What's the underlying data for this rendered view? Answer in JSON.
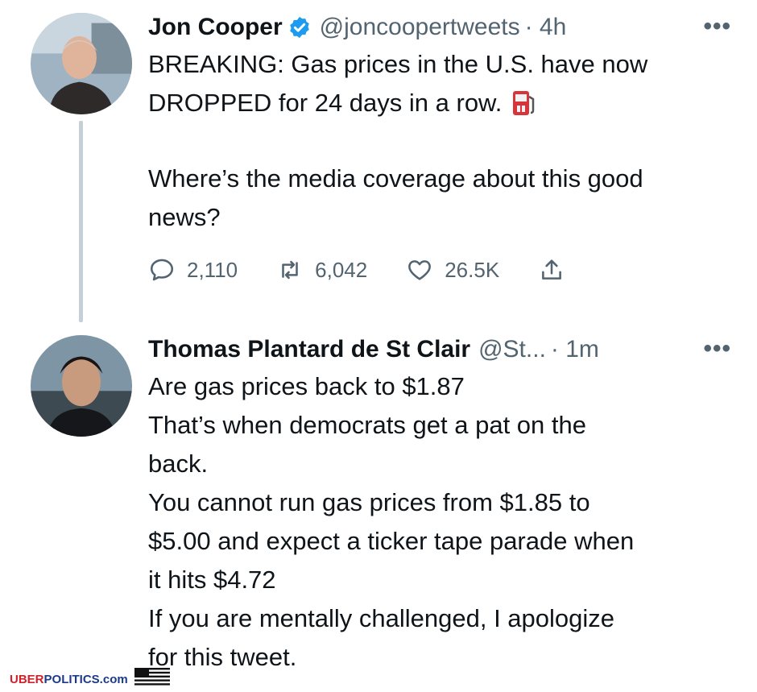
{
  "tweets": [
    {
      "name": "Jon Cooper",
      "verified": true,
      "handle": "@joncoopertweets",
      "time": "· 4h",
      "more": "•••",
      "line1": "BREAKING: Gas prices in the U.S. have now",
      "line2": "DROPPED for 24 days in a row.",
      "line3": "Where’s the media coverage about this good",
      "line4": "news?",
      "replies": "2,110",
      "retweets": "6,042",
      "likes": "26.5K"
    },
    {
      "name": "Thomas Plantard de St Clair",
      "handle": "@St...",
      "time": "· 1m",
      "more": "•••",
      "lines": [
        "Are gas prices back to $1.87",
        "That’s when democrats get a pat on the",
        "back.",
        "You cannot run gas prices from $1.85 to",
        "$5.00 and expect a ticker tape parade when",
        "it hits $4.72",
        "If you are mentally challenged, I apologize",
        "for this tweet."
      ]
    }
  ],
  "watermark": {
    "part1": "UBER",
    "part2": "POLITICS.com"
  },
  "colors": {
    "verified": "#1d9bf0",
    "secondary_text": "#536471",
    "thread_line": "#c4cfd6"
  }
}
